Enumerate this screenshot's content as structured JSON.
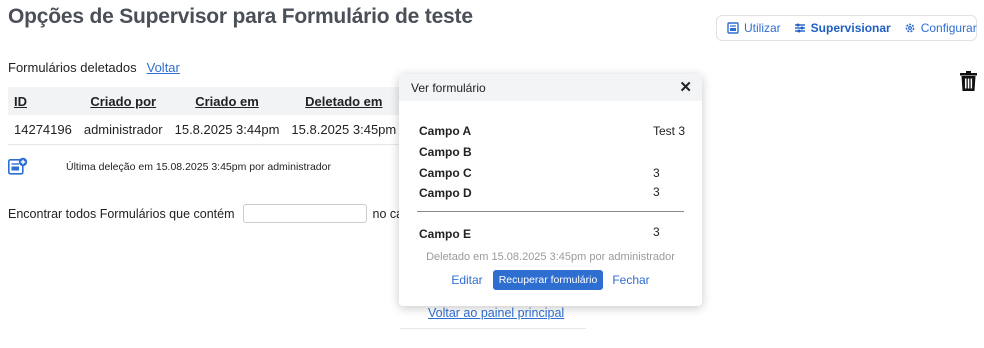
{
  "page_title": "Opções de Supervisor para Formulário de teste",
  "nav": {
    "utilizar": "Utilizar",
    "supervisionar": "Supervisionar",
    "configurar": "Configurar"
  },
  "deleted_section": {
    "label": "Formulários deletados",
    "back_link": "Voltar"
  },
  "table": {
    "headers": [
      "ID",
      "Criado por",
      "Criado em",
      "Deletado em"
    ],
    "rows": [
      {
        "id": "14274196",
        "criado_por": "administrador",
        "criado_em": "15.8.2025 3:44pm",
        "deletado_em": "15.8.2025 3:45pm"
      }
    ]
  },
  "last_deletion": "Última deleção em 15.08.2025 3:45pm por administrador",
  "search": {
    "label": "Encontrar todos Formulários que contém",
    "value": "",
    "suffix": "no camp"
  },
  "back_main": "Voltar ao painel principal",
  "modal": {
    "title": "Ver formulário",
    "close": "✕",
    "fields": [
      {
        "label": "Campo A",
        "value": "Test 3"
      },
      {
        "label": "Campo B",
        "value": ""
      },
      {
        "label": "Campo C",
        "value": "3"
      },
      {
        "label": "Campo D",
        "value": "3"
      }
    ],
    "field_e": {
      "label": "Campo E",
      "value": "3"
    },
    "deleted_note": "Deletado em 15.08.2025 3:45pm por administrador",
    "edit": "Editar",
    "recover": "Recuperar formulário",
    "close_link": "Fechar"
  },
  "colors": {
    "accent": "#2f6ed1",
    "title": "#4a4f58",
    "header_bg": "#f1f3f5"
  }
}
